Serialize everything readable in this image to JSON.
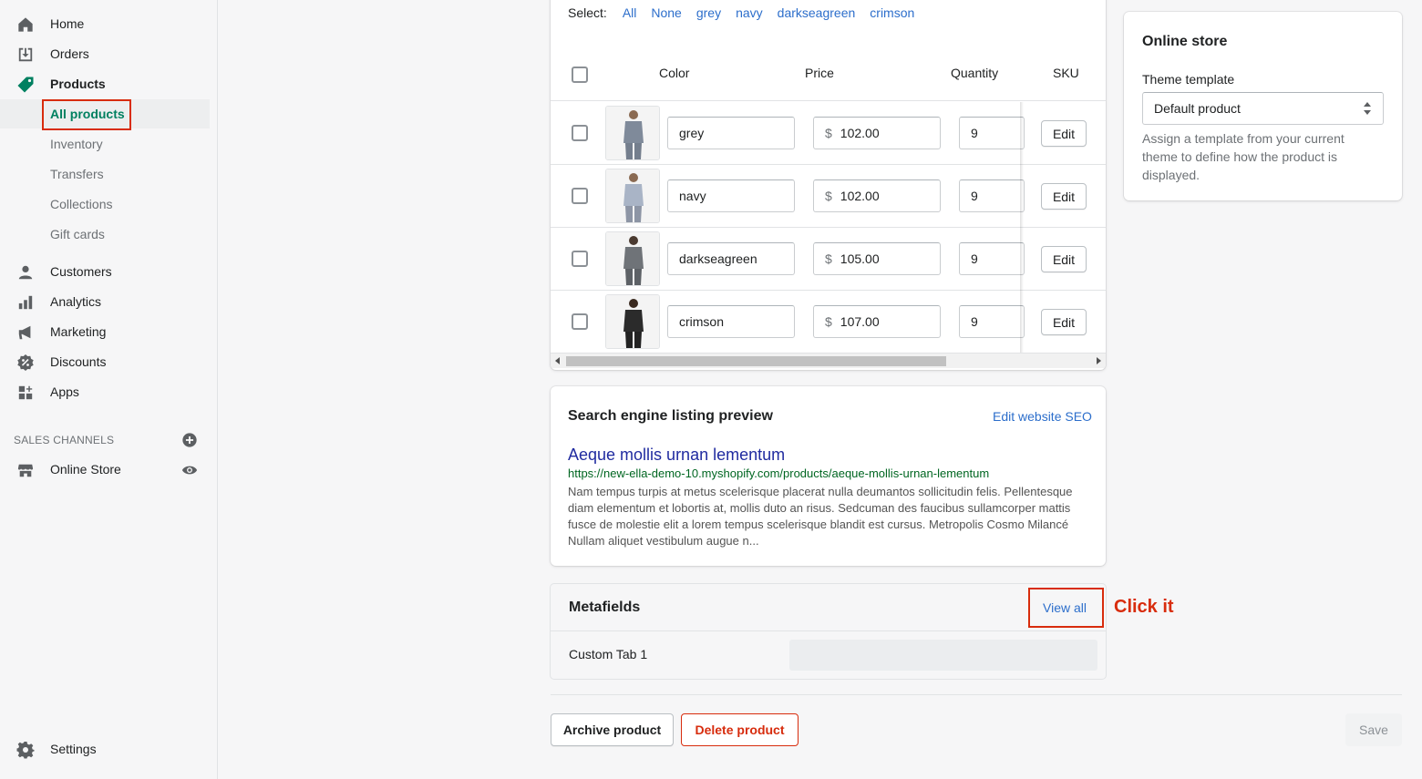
{
  "sidebar": {
    "items": [
      {
        "label": "Home",
        "icon": "home-icon"
      },
      {
        "label": "Orders",
        "icon": "orders-icon"
      },
      {
        "label": "Products",
        "icon": "tag-icon"
      },
      {
        "label": "Customers",
        "icon": "person-icon"
      },
      {
        "label": "Analytics",
        "icon": "bar-chart-icon"
      },
      {
        "label": "Marketing",
        "icon": "megaphone-icon"
      },
      {
        "label": "Discounts",
        "icon": "discount-icon"
      },
      {
        "label": "Apps",
        "icon": "apps-icon"
      }
    ],
    "products_sub": [
      "All products",
      "Inventory",
      "Transfers",
      "Collections",
      "Gift cards"
    ],
    "sales_channels_label": "SALES CHANNELS",
    "online_store_label": "Online Store",
    "settings_label": "Settings",
    "accent_color": "#008060"
  },
  "variants": {
    "select_label": "Select:",
    "select_links": [
      "All",
      "None",
      "grey",
      "navy",
      "darkseagreen",
      "crimson"
    ],
    "headers": {
      "color": "Color",
      "price": "Price",
      "quantity": "Quantity",
      "sku": "SKU"
    },
    "currency": "$",
    "edit_label": "Edit",
    "rows": [
      {
        "color": "grey",
        "price": "102.00",
        "quantity": "9"
      },
      {
        "color": "navy",
        "price": "102.00",
        "quantity": "9"
      },
      {
        "color": "darkseagreen",
        "price": "105.00",
        "quantity": "9"
      },
      {
        "color": "crimson",
        "price": "107.00",
        "quantity": "9"
      }
    ]
  },
  "seo": {
    "title": "Search engine listing preview",
    "edit_link": "Edit website SEO",
    "page_title": "Aeque mollis urnan lementum",
    "url": "https://new-ella-demo-10.myshopify.com/products/aeque-mollis-urnan-lementum",
    "description": "Nam tempus turpis at metus scelerisque placerat nulla deumantos sollicitudin felis. Pellentesque diam elementum et lobortis at, mollis duto an risus. Sedcuman des faucibus sullamcorper mattis fusce de molestie elit a lorem tempus scelerisque blandit est cursus. Metropolis Cosmo Milancé Nullam aliquet vestibulum augue n..."
  },
  "metafields": {
    "title": "Metafields",
    "view_all": "View all",
    "field_label": "Custom Tab 1",
    "annotation": "Click it"
  },
  "online_store": {
    "title": "Online store",
    "theme_label": "Theme template",
    "theme_value": "Default product",
    "help": "Assign a template from your current theme to define how the product is displayed."
  },
  "actions": {
    "archive": "Archive product",
    "delete": "Delete product",
    "save": "Save"
  }
}
